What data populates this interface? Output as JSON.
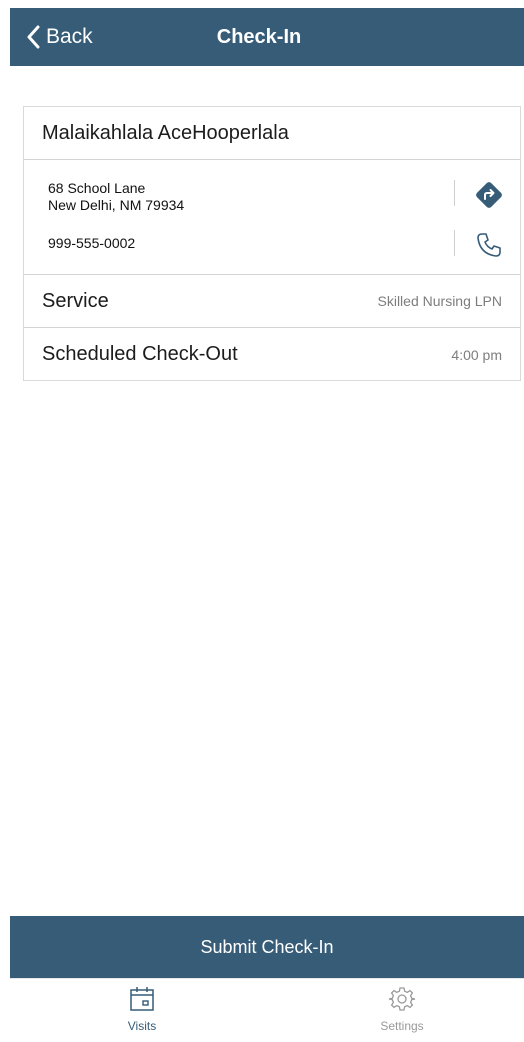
{
  "header": {
    "back_label": "Back",
    "title": "Check-In"
  },
  "client": {
    "name": "Malaikahlala AceHooperlala",
    "address_line1": "68 School Lane",
    "address_line2": "New Delhi, NM 79934",
    "phone": "999-555-0002"
  },
  "details": {
    "service_label": "Service",
    "service_value": "Skilled Nursing LPN",
    "checkout_label": "Scheduled Check-Out",
    "checkout_value": "4:00 pm"
  },
  "submit_label": "Submit Check-In",
  "tabs": [
    {
      "label": "Visits",
      "icon": "calendar-icon",
      "active": true
    },
    {
      "label": "Settings",
      "icon": "gear-icon",
      "active": false
    }
  ],
  "colors": {
    "primary": "#365c77",
    "inactive_tab": "#9a9a9a",
    "secondary_text": "#7d7d7d"
  }
}
